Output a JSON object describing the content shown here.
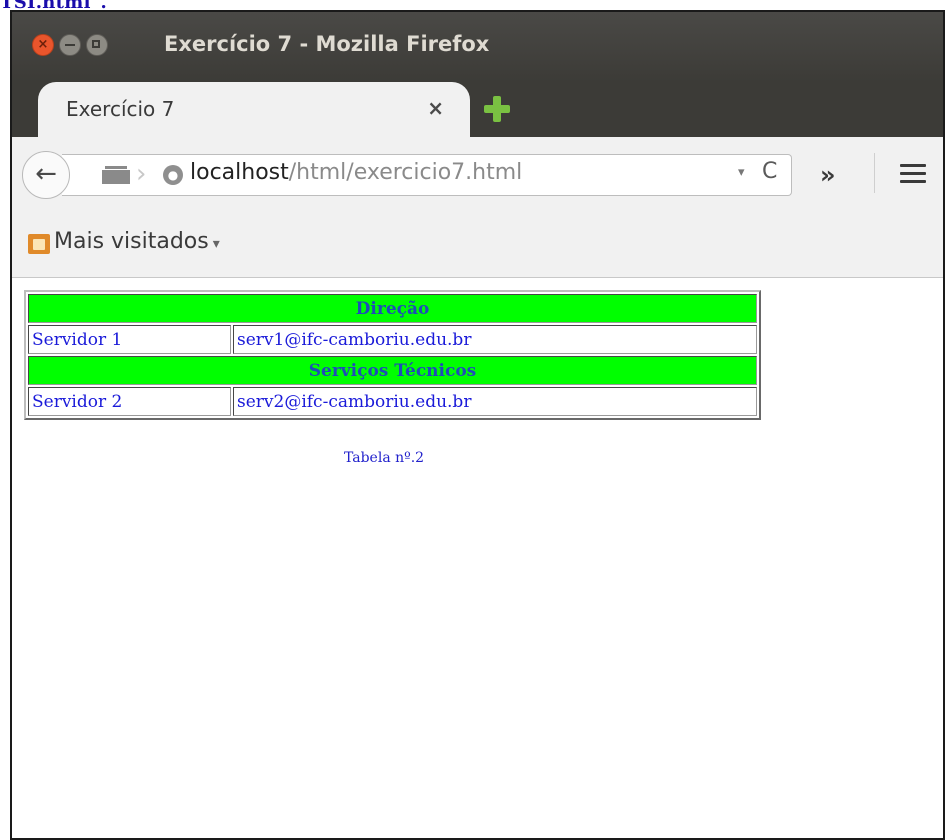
{
  "page_fragment": "TSI.html\".",
  "window": {
    "title": "Exercício 7 - Mozilla Firefox",
    "close_glyph": "×"
  },
  "tab": {
    "title": "Exercício 7",
    "close_glyph": "×"
  },
  "navbar": {
    "back_glyph": "←",
    "url_host": "localhost",
    "url_path": "/html/exercicio7.html",
    "dropdown_glyph": "▾",
    "reload_glyph": "C",
    "overflow_glyph": "»"
  },
  "bookmarks": {
    "label": "Mais visitados",
    "caret": "▾"
  },
  "table": {
    "sections": [
      {
        "header": "Direção",
        "name": "Servidor 1",
        "email": "serv1@ifc-camboriu.edu.br"
      },
      {
        "header": "Serviços Técnicos",
        "name": "Servidor 2",
        "email": "serv2@ifc-camboriu.edu.br"
      }
    ],
    "caption": "Tabela nº.2"
  },
  "colors": {
    "header_bg": "#00ff00",
    "link_text": "#1a1ad9",
    "titlebar": "#3c3b37",
    "close_button": "#e9552c",
    "new_tab_icon": "#7ac142"
  }
}
